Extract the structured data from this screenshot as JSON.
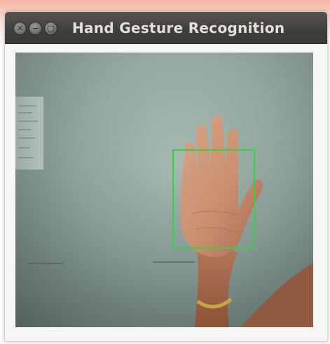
{
  "window": {
    "title": "Hand Gesture Recognition",
    "controls": [
      {
        "name": "close",
        "glyph": "✕"
      },
      {
        "name": "minimize",
        "glyph": "−"
      },
      {
        "name": "maximize",
        "glyph": "□"
      }
    ]
  },
  "camera_feed": {
    "detection_box_color": "#39d13f",
    "titlebar_color": "#3f3d3a"
  }
}
